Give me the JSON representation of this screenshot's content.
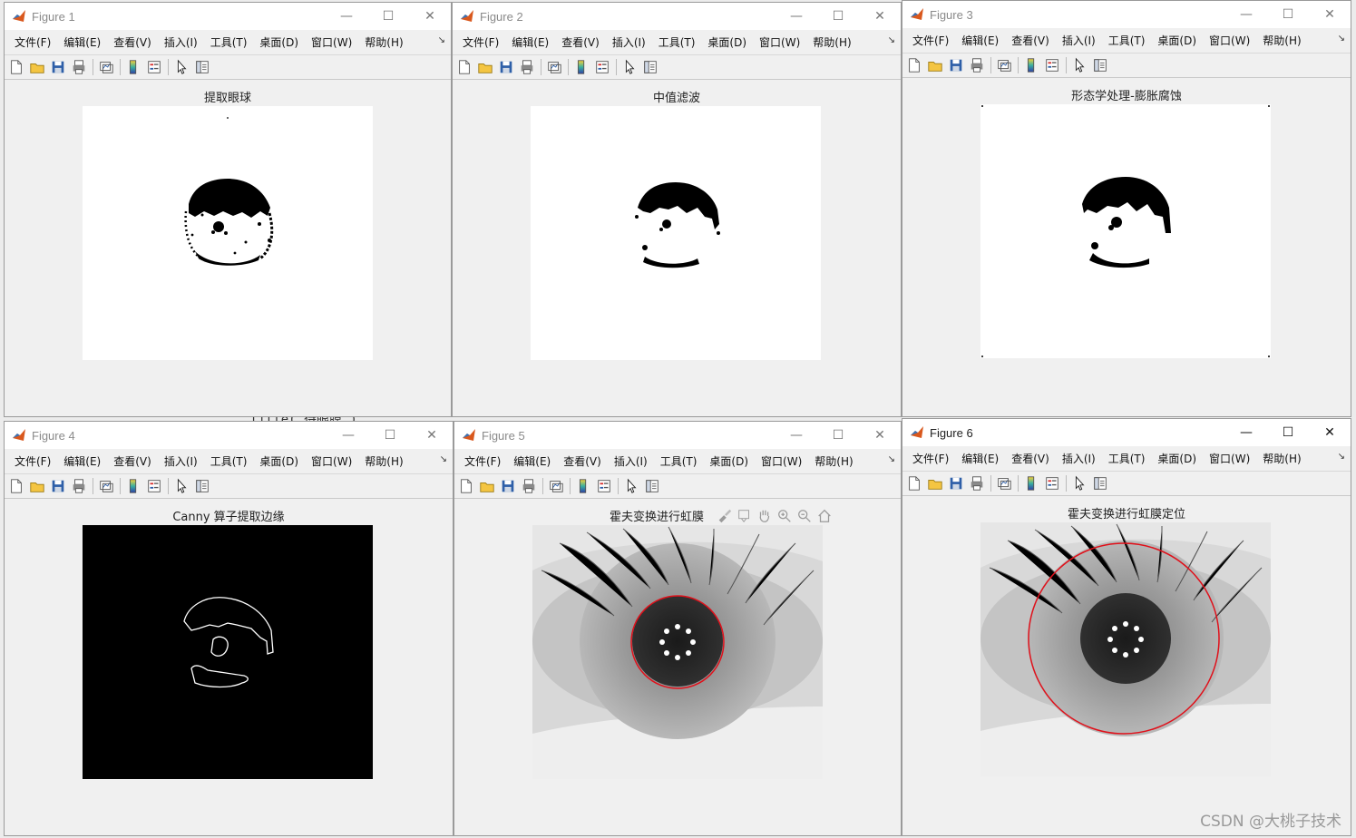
{
  "menus": [
    "文件(F)",
    "编辑(E)",
    "查看(V)",
    "插入(I)",
    "工具(T)",
    "桌面(D)",
    "窗口(W)",
    "帮助(H)"
  ],
  "window_controls": {
    "minimize": "—",
    "maximize": "☐",
    "close": "✕"
  },
  "toolbar_icons": [
    "new-file-icon",
    "open-folder-icon",
    "save-icon",
    "print-icon",
    "link-plot-icon",
    "insert-colorbar-icon",
    "insert-legend-icon",
    "edit-plot-arrow-icon",
    "property-inspector-icon"
  ],
  "axes_toolbar_icons": [
    "brush-icon",
    "data-tips-icon",
    "pan-hand-icon",
    "zoom-in-icon",
    "zoom-out-icon",
    "restore-view-home-icon"
  ],
  "figures": [
    {
      "title": "Figure 1",
      "plot_title": "提取眼球",
      "image": "binary-eyeball",
      "active": false
    },
    {
      "title": "Figure 2",
      "plot_title": "中值滤波",
      "image": "median-filtered",
      "active": false
    },
    {
      "title": "Figure 3",
      "plot_title": "形态学处理-膨胀腐蚀",
      "image": "morphology",
      "active": false
    },
    {
      "title": "Figure 4",
      "plot_title": "Canny 算子提取边缘",
      "image": "canny-edges",
      "active": false
    },
    {
      "title": "Figure 5",
      "plot_title": "霍夫变换进行虹膜",
      "image": "eye-pupil-circle",
      "active": false
    },
    {
      "title": "Figure 6",
      "plot_title": "霍夫变换进行虹膜定位",
      "image": "eye-iris-circle",
      "active": true
    }
  ],
  "background_code_fragment": "title( 待眼膜 )",
  "watermark": "CSDN @大桃子技术",
  "colors": {
    "detection_circle": "#e0101a",
    "window_bg": "#f0f0f0",
    "title_inactive": "#8a8a8a"
  }
}
